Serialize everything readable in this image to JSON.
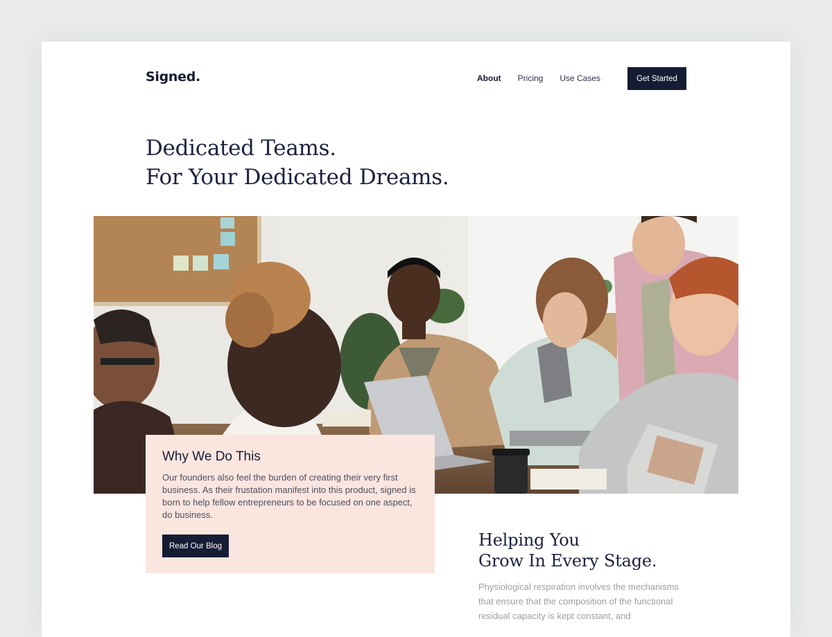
{
  "brand": {
    "logo": "Signed."
  },
  "nav": {
    "items": [
      {
        "label": "About",
        "active": true
      },
      {
        "label": "Pricing",
        "active": false
      },
      {
        "label": "Use Cases",
        "active": false
      }
    ],
    "cta_label": "Get Started"
  },
  "hero": {
    "line1": "Dedicated Teams.",
    "line2": "For Your Dedicated Dreams."
  },
  "why": {
    "title": "Why We Do This",
    "text": "Our founders also feel the burden of creating their very first business. As their frustation manifest into this product, signed is born to help fellow entrepreneurs to be focused on one aspect, do business.",
    "button_label": "Read Our Blog"
  },
  "grow": {
    "line1": "Helping You",
    "line2": "Grow In Every Stage.",
    "text": "Physiological respiration involves the mechanisms that ensure that the composition of the functional residual capacity is kept constant, and"
  },
  "colors": {
    "page_bg": "#e8ebea",
    "navy": "#151c33",
    "peach": "#fbe5df",
    "muted_text": "#9a9ea8"
  }
}
